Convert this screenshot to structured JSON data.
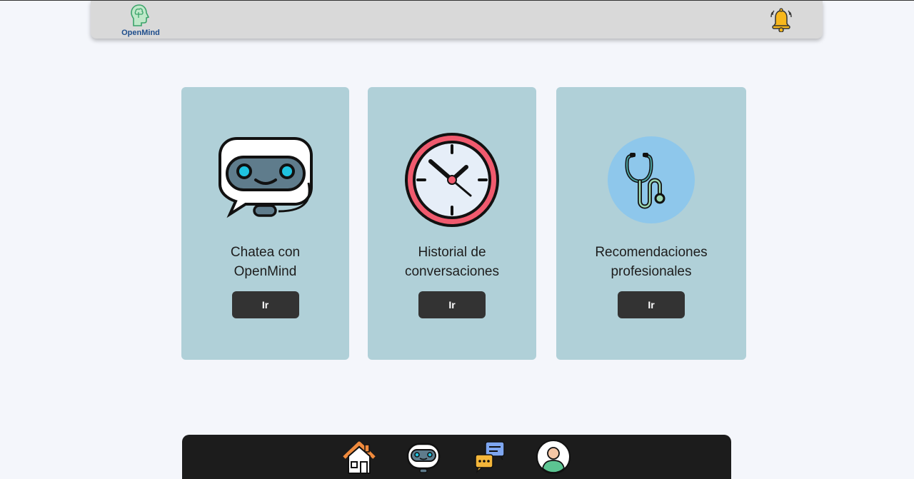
{
  "header": {
    "logo_text": "OpenMind",
    "logo_icon": "brain-head-icon",
    "notification_icon": "bell-icon"
  },
  "cards": [
    {
      "icon": "robot-chat-icon",
      "title_line1": "Chatea con",
      "title_line2": "OpenMind",
      "button_label": "Ir"
    },
    {
      "icon": "clock-icon",
      "title_line1": "Historial de",
      "title_line2": "conversaciones",
      "button_label": "Ir"
    },
    {
      "icon": "stethoscope-icon",
      "title_line1": "Recomendaciones",
      "title_line2": "profesionales",
      "button_label": "Ir"
    }
  ],
  "bottom_nav": {
    "items": [
      {
        "icon": "home-icon"
      },
      {
        "icon": "robot-icon"
      },
      {
        "icon": "chat-bubbles-icon"
      },
      {
        "icon": "user-avatar-icon"
      }
    ]
  },
  "colors": {
    "page_background": "#f4f6fb",
    "header_background": "#d9d9d9",
    "card_background": "#b0d0d8",
    "button_background": "#333333",
    "nav_background": "#1c1c1c",
    "logo_text": "#1f4e8c"
  }
}
